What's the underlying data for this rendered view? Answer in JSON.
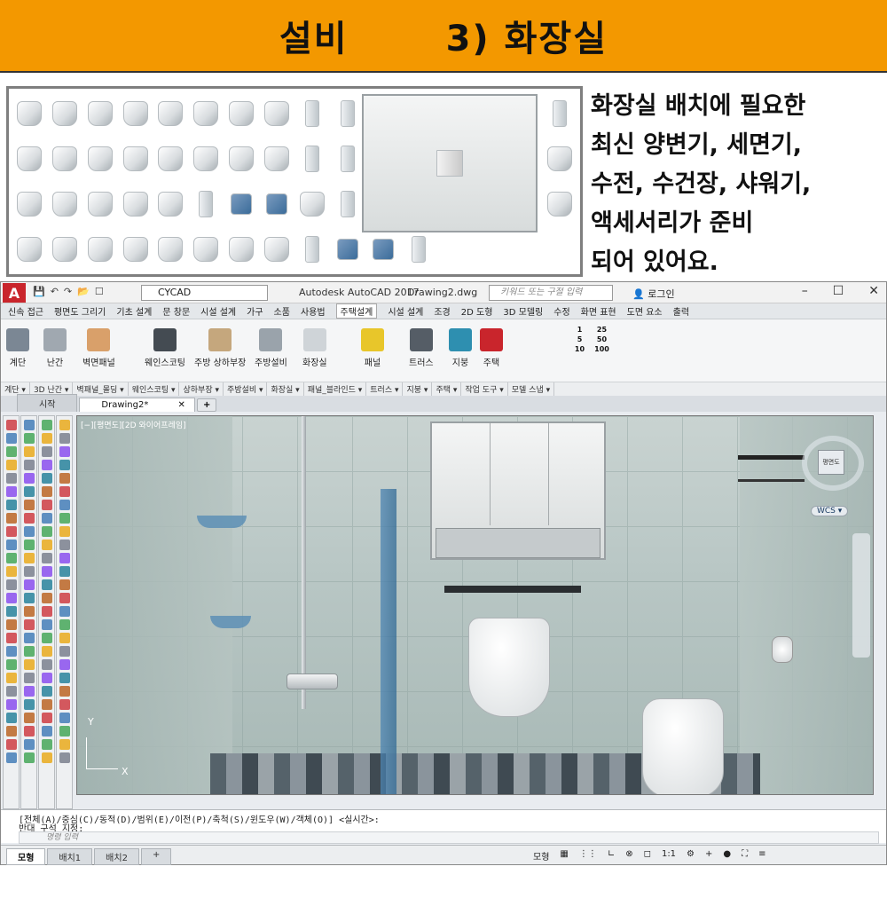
{
  "banner": {
    "left_title": "설비",
    "right_title": "3) 화장실",
    "color": "#f39800"
  },
  "description": {
    "lines": [
      "화장실 배치에 필요한",
      "최신 양변기, 세면기,",
      "수전, 수건장, 샤워기,",
      "액세서리가 준비",
      "되어 있어요."
    ]
  },
  "window": {
    "app_logo": "A",
    "workspace": "CYCAD",
    "app_title": "Autodesk AutoCAD 2017",
    "document_title": "Drawing2.dwg",
    "search_placeholder": "키워드 또는 구절 입력",
    "login_label": "로그인",
    "controls": [
      "–",
      "☐",
      "✕"
    ]
  },
  "menu": {
    "items": [
      "신속 접근",
      "평면도 그리기",
      "기초 설계",
      "문 창문",
      "시설 설계",
      "가구",
      "소품",
      "사용법",
      "주택설계",
      "시설 설계",
      "조경",
      "2D 도형",
      "3D 모델링",
      "수정",
      "화면 표현",
      "도면 요소",
      "출력"
    ],
    "active_index": 8
  },
  "ribbon": {
    "tools": [
      {
        "label": "계단",
        "color": "#7b8794"
      },
      {
        "label": "난간",
        "color": "#a0a8b0"
      },
      {
        "label": "벽면패널",
        "color": "#d9a06a"
      },
      {
        "label": "웨인스코팅",
        "color": "#444b52"
      },
      {
        "label": "주방 상하부장",
        "color": "#c5a77d"
      },
      {
        "label": "주방설비",
        "color": "#9aa3ab"
      },
      {
        "label": "화장실",
        "color": "#cfd4d8"
      },
      {
        "label": "패널",
        "color": "#e8c62a"
      },
      {
        "label": "트러스",
        "color": "#555d66"
      },
      {
        "label": "지붕",
        "color": "#2e8fb0"
      },
      {
        "label": "주택",
        "color": "#c9252c"
      }
    ],
    "group_labels": [
      "계단 ▾",
      "3D 난간 ▾",
      "벽패널_몰딩 ▾",
      "웨인스코팅 ▾",
      "상하부장 ▾",
      "주방설비 ▾",
      "화장실 ▾",
      "패널_블라인드 ▾",
      "트러스 ▾",
      "지붕 ▾",
      "주택 ▾",
      "작업 도구 ▾",
      "모델 스냅 ▾"
    ],
    "scales": [
      "1",
      "25",
      "5",
      "50",
      "10",
      "100"
    ]
  },
  "doc_tabs": {
    "start": "시작",
    "active": "Drawing2*",
    "close": "✕",
    "plus": "+"
  },
  "viewport": {
    "label": "[−][평면도][2D 와이어프레임]",
    "viewcube_face": "평면도",
    "wcs": "WCS ▾",
    "axis_x": "X",
    "axis_y": "Y"
  },
  "command": {
    "line1": "[전체(A)/중심(C)/동적(D)/범위(E)/이전(P)/축척(S)/윈도우(W)/객체(O)] <실시간>:",
    "line2": "반대 구석 지정:",
    "input_placeholder": "명령 입력"
  },
  "status": {
    "layout_tabs": [
      "모형",
      "배치1",
      "배치2",
      "+"
    ],
    "model_label": "모형",
    "scale": "1:1"
  }
}
